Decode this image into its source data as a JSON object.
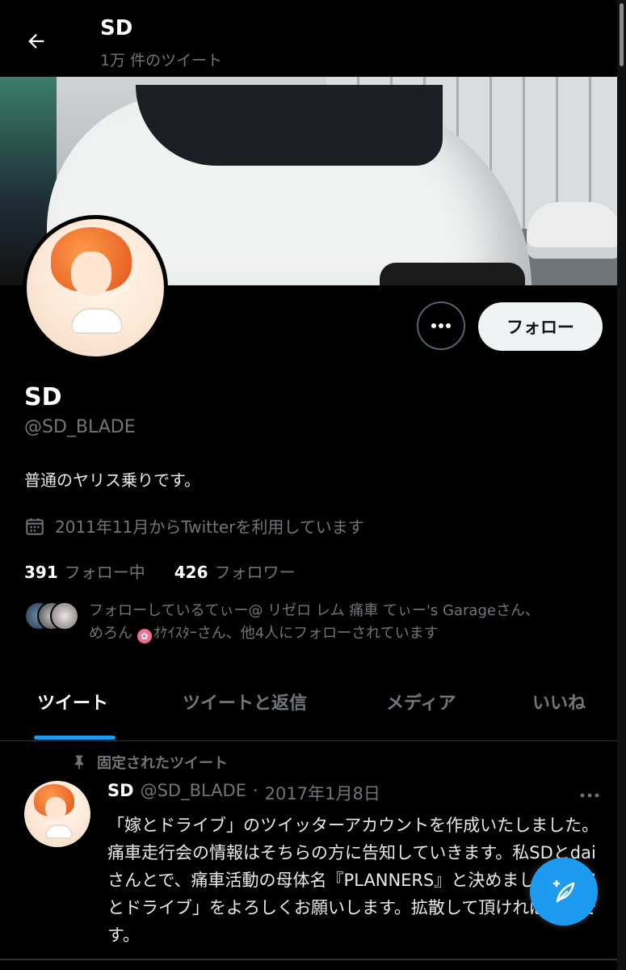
{
  "header": {
    "title": "SD",
    "tweet_count": "1万 件のツイート"
  },
  "profile": {
    "follow_label": "フォロー",
    "display_name": "SD",
    "handle": "@SD_BLADE",
    "bio": "普通のヤリス乗りです。",
    "joined": "2011年11月からTwitterを利用しています",
    "following_count": "391",
    "following_label": "フォロー中",
    "followers_count": "426",
    "followers_label": "フォロワー",
    "followed_by_line1": "フォローしているてぃー@ リゼロ レム 痛車 てぃー's Garageさん、",
    "followed_by_line2_a": "めろん",
    "followed_by_line2_b": "ｵｹｲｽﾀｰさん、他4人にフォローされています"
  },
  "tabs": [
    {
      "label": "ツイート"
    },
    {
      "label": "ツイートと返信"
    },
    {
      "label": "メディア"
    },
    {
      "label": "いいね"
    }
  ],
  "tweet": {
    "pinned_label": "固定されたツイート",
    "author_name": "SD",
    "author_handle": "@SD_BLADE",
    "separator": "·",
    "date": "2017年1月8日",
    "text": "「嫁とドライブ」のツイッターアカウントを作成いたしました。痛車走行会の情報はそちらの方に告知していきます。私SDとdaiさんとで、痛車活動の母体名『PLANNERS』と決めました。「嫁とドライブ」をよろしくお願いします。拡散して頂ければ幸いです。"
  },
  "colors": {
    "accent": "#1d9bf0",
    "background": "#000000",
    "muted_text": "#71767b"
  },
  "icons": {
    "back": "arrow-left-icon",
    "more": "more-dots-icon",
    "calendar": "calendar-icon",
    "pin": "pin-icon",
    "compose": "compose-feather-icon"
  }
}
